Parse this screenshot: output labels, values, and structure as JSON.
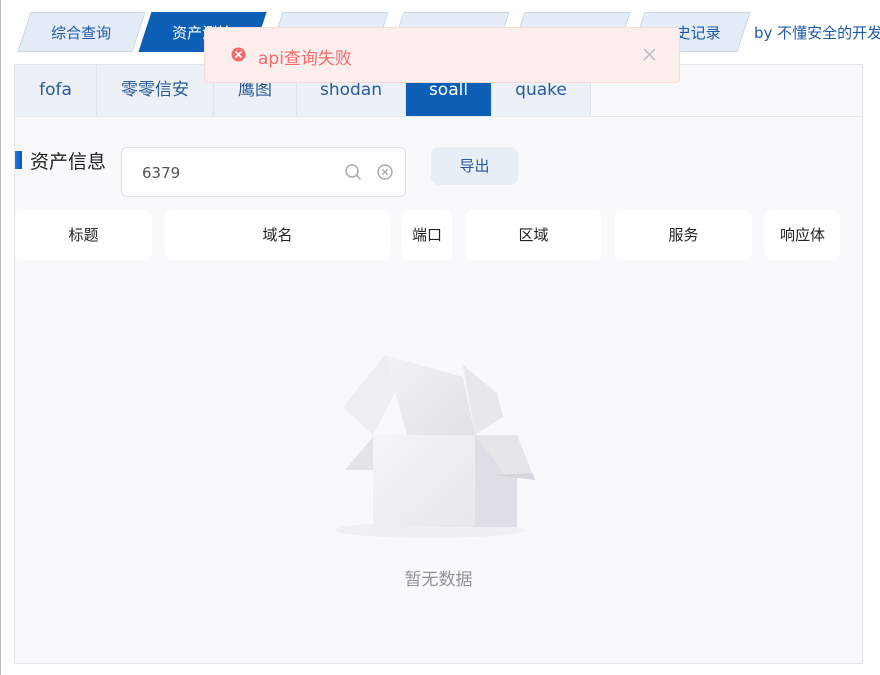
{
  "top_tabs": [
    {
      "label": "综合查询",
      "active": false
    },
    {
      "label": "资产测绘",
      "active": true
    },
    {
      "label": "",
      "active": false
    },
    {
      "label": "",
      "active": false
    },
    {
      "label": "",
      "active": false
    },
    {
      "label": "史记录",
      "active": false
    }
  ],
  "byline": "by 不懂安全的开发",
  "inner_tabs": [
    {
      "label": "fofa",
      "active": false
    },
    {
      "label": "零零信安",
      "active": false
    },
    {
      "label": "鹰图",
      "active": false
    },
    {
      "label": "shodan",
      "active": false
    },
    {
      "label": "soall",
      "active": true
    },
    {
      "label": "quake",
      "active": false
    }
  ],
  "section_title": "资产信息",
  "search": {
    "value": "6379"
  },
  "export_label": "导出",
  "columns": [
    "标题",
    "域名",
    "端口",
    "区域",
    "服务",
    "响应体"
  ],
  "empty_text": "暂无数据",
  "alert": {
    "message": "api查询失败",
    "type": "error"
  },
  "colors": {
    "accent": "#0d5fb5",
    "error": "#f56c6c",
    "error_bg": "#fdeeee"
  }
}
